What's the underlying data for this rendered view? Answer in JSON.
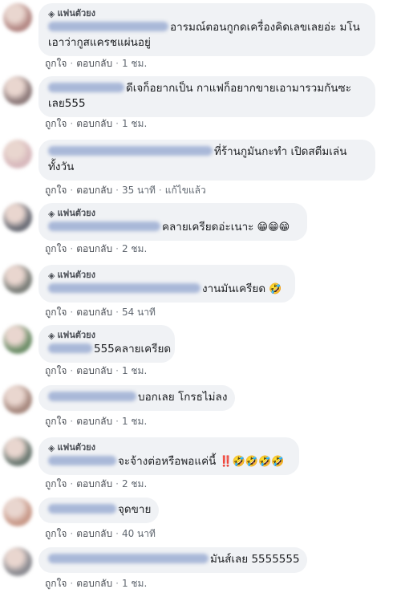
{
  "fan_badge": "แฟนตัวยง",
  "like_label": "ถูกใจ",
  "reply_label": "ตอบกลับ",
  "comments": [
    {
      "badge": true,
      "lines": [
        "อารมณ์ตอนกูกดเครื่องคิดเลขเลยอ่ะ มโน",
        "เอาว่ากูสแครชแผ่นอยู่"
      ],
      "time": "1 ชม.",
      "edited": ""
    },
    {
      "badge": false,
      "lines": [
        "ดีเจก็อยากเป็น กาแฟก็อยากขายเอามารวมกันซะ",
        "เลย555"
      ],
      "time": "1 ชม.",
      "edited": ""
    },
    {
      "badge": false,
      "lines": [
        "ที่ร้านกูมันกะทำ เปิดสตีมเล่น",
        "ทั้งวัน"
      ],
      "time": "35 นาที",
      "edited": "แก้ไขแล้ว"
    },
    {
      "badge": true,
      "lines": [
        "คลายเครียดอ่ะเนาะ"
      ],
      "emoji": "😁😁😁",
      "time": "2 ชม.",
      "edited": ""
    },
    {
      "badge": true,
      "lines": [
        "งานมันเครียด"
      ],
      "emoji": "🤣",
      "time": "54 นาที",
      "edited": ""
    },
    {
      "badge": true,
      "lines": [
        "555คลายเครียด"
      ],
      "time": "1 ชม.",
      "edited": ""
    },
    {
      "badge": false,
      "lines": [
        "บอกเลย โกรธไม่ลง"
      ],
      "time": "1 ชม.",
      "edited": ""
    },
    {
      "badge": true,
      "lines": [
        "จะจ้างต่อหรือพอแค่นี้"
      ],
      "emoji": "‼️🤣🤣🤣🤣",
      "time": "2 ชม.",
      "edited": ""
    },
    {
      "badge": false,
      "lines": [
        "จุดขาย"
      ],
      "time": "40 นาที",
      "edited": ""
    },
    {
      "badge": false,
      "lines": [
        "มันส์เลย 5555555"
      ],
      "time": "1 ชม.",
      "edited": ""
    }
  ]
}
